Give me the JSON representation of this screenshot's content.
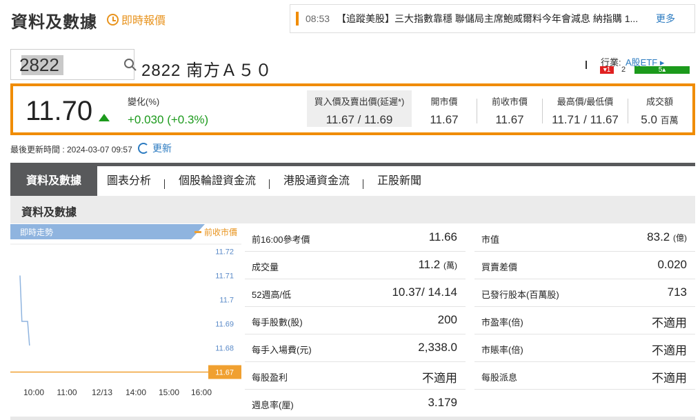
{
  "header": {
    "title": "資料及數據",
    "realtime_label": "即時報價"
  },
  "news": {
    "time": "08:53",
    "text": "【追蹤美股】三大指數靠穩 聯儲局主席鮑威爾料今年會減息 納指購 1...",
    "more": "更多"
  },
  "search": {
    "value": "2822"
  },
  "stock": {
    "name": "2822 南方Ａ５０"
  },
  "industry": {
    "label": "行業:",
    "value": "A股ETF",
    "down_count": "1",
    "flat_count": "2",
    "up_count": "5"
  },
  "quote": {
    "price": "11.70",
    "change_label": "變化(%)",
    "change_value": "+0.030 (+0.3%)",
    "bidask_label": "買入價及賣出價(延遲*)",
    "bidask_value": "11.67 / 11.69",
    "open_label": "開市價",
    "open_value": "11.67",
    "prevclose_label": "前收市價",
    "prevclose_value": "11.67",
    "highlow_label": "最高價/最低價",
    "highlow_value": "11.71 / 11.67",
    "turnover_label": "成交額",
    "turnover_value": "5.0",
    "turnover_unit": "百萬"
  },
  "update": {
    "text": "最後更新時間 : 2024-03-07 09:57",
    "refresh": "更新"
  },
  "tabs": [
    {
      "label": "資料及數據"
    },
    {
      "label": "圖表分析"
    },
    {
      "label": "個股輪證資金流"
    },
    {
      "label": "港股通資金流"
    },
    {
      "label": "正股新聞"
    }
  ],
  "section": {
    "title": "資料及數據"
  },
  "chart_data": {
    "type": "line",
    "title": "即時走勢",
    "legend": [
      "前收市價"
    ],
    "prev_close": 11.67,
    "prev_close_label": "11.67",
    "ylim": [
      11.665,
      11.725
    ],
    "y_ticks": [
      "11.72",
      "11.71",
      "11.7",
      "11.69",
      "11.68"
    ],
    "y_tick_values": [
      11.72,
      11.71,
      11.7,
      11.69,
      11.68
    ],
    "x_ticks": [
      "10:00",
      "11:00",
      "12/13",
      "14:00",
      "15:00",
      "16:00"
    ],
    "series": [
      {
        "x": [
          0,
          5,
          10,
          15,
          20,
          25
        ],
        "values": [
          11.71,
          11.691,
          11.691,
          11.691,
          11.691,
          11.681
        ]
      }
    ],
    "x_max": 500
  },
  "table_left": [
    {
      "key": "前16:00參考價",
      "value": "11.66",
      "unit": ""
    },
    {
      "key": "成交量",
      "value": "11.2",
      "unit": "(萬)"
    },
    {
      "key": "52週高/低",
      "value": "10.37/ 14.14",
      "unit": ""
    },
    {
      "key": "每手股數(股)",
      "value": "200",
      "unit": ""
    },
    {
      "key": "每手入場費(元)",
      "value": "2,338.0",
      "unit": ""
    },
    {
      "key": "每股盈利",
      "value": "不適用",
      "unit": ""
    },
    {
      "key": "週息率(厘)",
      "value": "3.179",
      "unit": ""
    }
  ],
  "table_right": [
    {
      "key": "市值",
      "value": "83.2",
      "unit": "(億)"
    },
    {
      "key": "買賣差價",
      "value": "0.020",
      "unit": ""
    },
    {
      "key": "已發行股本(百萬股)",
      "value": "713",
      "unit": ""
    },
    {
      "key": "市盈率(倍)",
      "value": "不適用",
      "unit": ""
    },
    {
      "key": "市賬率(倍)",
      "value": "不適用",
      "unit": ""
    },
    {
      "key": "每股派息",
      "value": "不適用",
      "unit": ""
    }
  ],
  "colors": {
    "accent_orange": "#f08c00",
    "up_green": "#1c9a1c",
    "down_red": "#e02020",
    "link_blue": "#2a7ac0",
    "tab_dark": "#58595b",
    "chart_line": "#8fb4df"
  }
}
